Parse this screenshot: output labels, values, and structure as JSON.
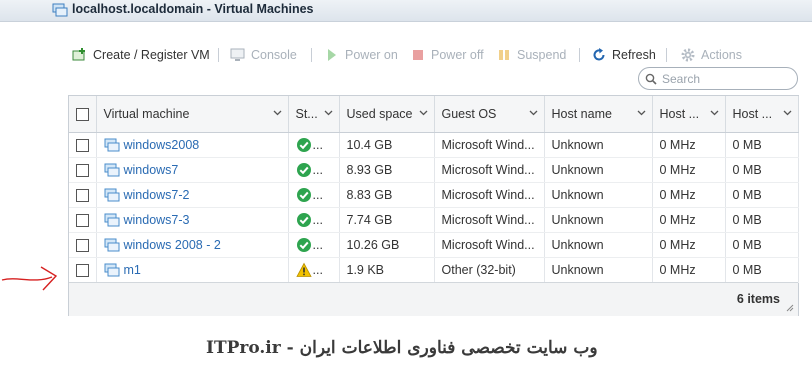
{
  "window": {
    "title": "localhost.localdomain - Virtual Machines"
  },
  "toolbar": {
    "create": "Create / Register VM",
    "console": "Console",
    "power_on": "Power on",
    "power_off": "Power off",
    "suspend": "Suspend",
    "refresh": "Refresh",
    "actions": "Actions"
  },
  "search": {
    "placeholder": "Search",
    "value": ""
  },
  "table": {
    "columns": [
      "Virtual machine",
      "St...",
      "Used space",
      "Guest OS",
      "Host name",
      "Host ...",
      "Host ..."
    ],
    "rows": [
      {
        "name": "windows2008",
        "status": "ok",
        "status_text": "...",
        "used": "10.4 GB",
        "os": "Microsoft Wind...",
        "host": "Unknown",
        "cpu": "0 MHz",
        "mem": "0 MB"
      },
      {
        "name": "windows7",
        "status": "ok",
        "status_text": "...",
        "used": "8.93 GB",
        "os": "Microsoft Wind...",
        "host": "Unknown",
        "cpu": "0 MHz",
        "mem": "0 MB"
      },
      {
        "name": "windows7-2",
        "status": "ok",
        "status_text": "...",
        "used": "8.83 GB",
        "os": "Microsoft Wind...",
        "host": "Unknown",
        "cpu": "0 MHz",
        "mem": "0 MB"
      },
      {
        "name": "windows7-3",
        "status": "ok",
        "status_text": "...",
        "used": "7.74 GB",
        "os": "Microsoft Wind...",
        "host": "Unknown",
        "cpu": "0 MHz",
        "mem": "0 MB"
      },
      {
        "name": "windows 2008 - 2",
        "status": "ok",
        "status_text": "...",
        "used": "10.26 GB",
        "os": "Microsoft Wind...",
        "host": "Unknown",
        "cpu": "0 MHz",
        "mem": "0 MB"
      },
      {
        "name": "m1",
        "status": "warning",
        "status_text": "...",
        "used": "1.9 KB",
        "os": "Other (32-bit)",
        "host": "Unknown",
        "cpu": "0 MHz",
        "mem": "0 MB"
      }
    ],
    "footer": "6 items"
  },
  "watermark": "ITPro.ir - وب سایت تخصصی فناوری اطلاعات ایران",
  "colors": {
    "link": "#2a6bb3",
    "ok": "#2ea44f",
    "warning": "#f2c200",
    "annotation_arrow": "#d62020"
  }
}
